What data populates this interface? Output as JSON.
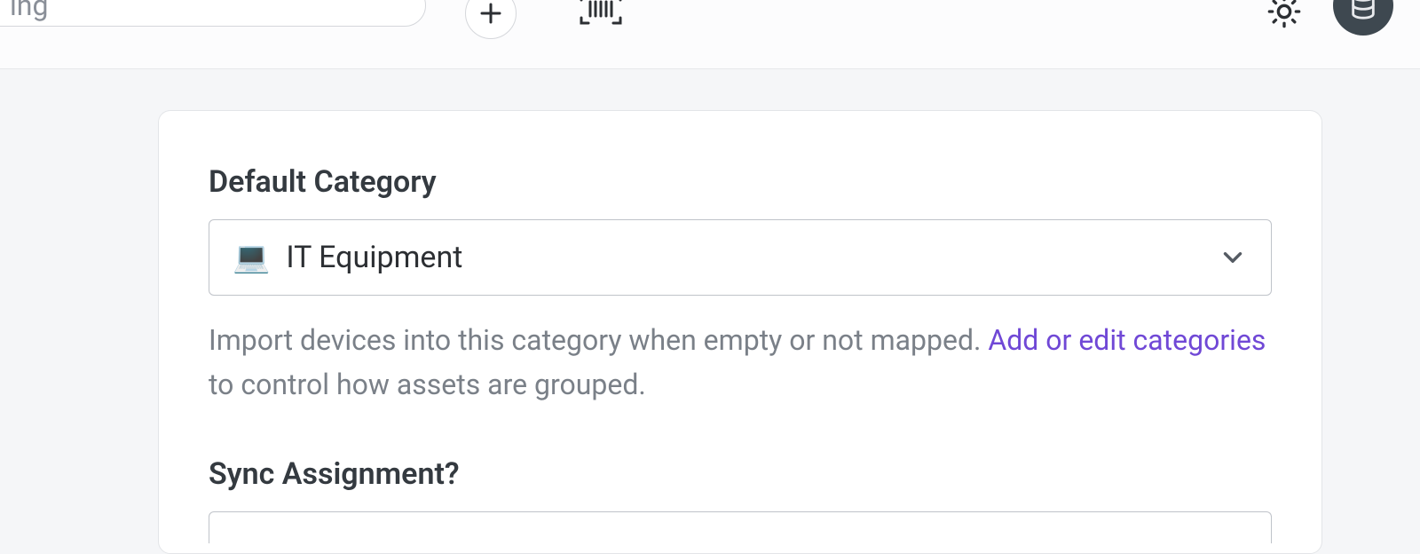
{
  "topbar": {
    "search_fragment": "ing"
  },
  "card": {
    "field1": {
      "label": "Default Category",
      "select_icon": "💻",
      "select_value": "IT Equipment",
      "help_pre": "Import devices into this category when empty or not mapped. ",
      "help_link": "Add or edit categories",
      "help_post": " to control how assets are grouped."
    },
    "field2": {
      "label": "Sync Assignment?"
    }
  }
}
